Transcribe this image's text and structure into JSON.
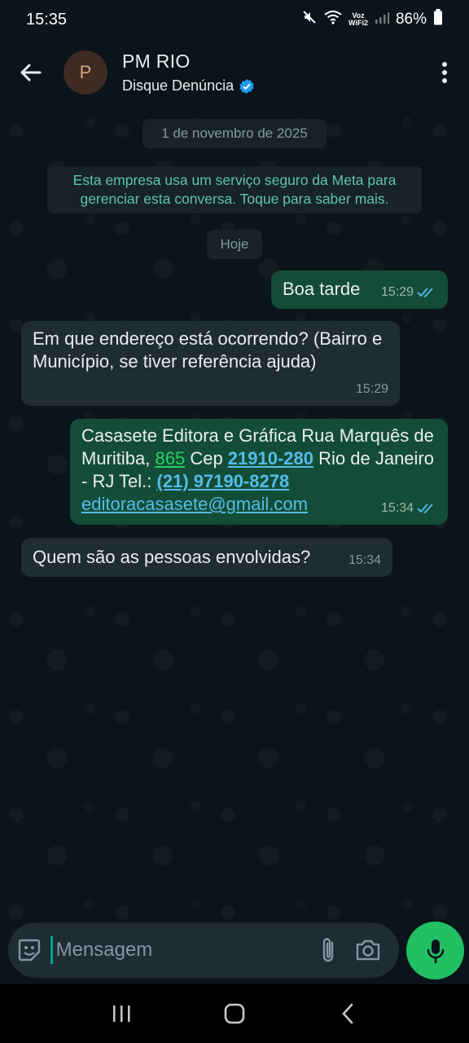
{
  "status_bar": {
    "time": "15:35",
    "voz_line1": "Voz",
    "voz_line2": "WiFi2",
    "battery": "86%"
  },
  "header": {
    "avatar_letter": "P",
    "name": "PM RIO",
    "subtitle": "Disque Denúncia",
    "verified_icon": "verified-badge-icon"
  },
  "chat": {
    "date_pill": "1 de novembro de 2025",
    "info_notice": "Esta empresa usa um serviço seguro da Meta para gerenciar esta conversa. Toque para saber mais.",
    "today_pill": "Hoje",
    "messages": [
      {
        "direction": "out",
        "text": "Boa tarde",
        "time": "15:29",
        "status": "read"
      },
      {
        "direction": "in",
        "text": "Em que endereço está ocorrendo? (Bairro e Município, se tiver referência ajuda)",
        "time": "15:29"
      },
      {
        "direction": "out",
        "text_part1": "Casasete Editora e Gráfica Rua Marquês de Muritiba, ",
        "number": "865",
        "text_part2": " Cep ",
        "cep": "21910-280",
        "text_part3": " Rio de Janeiro - RJ Tel.: ",
        "phone": "(21) 97190-8278",
        "email": "editoracasasete@gmail.com",
        "time": "15:34",
        "status": "read"
      },
      {
        "direction": "in",
        "text": "Quem são as pessoas envolvidas?",
        "time": "15:34"
      }
    ]
  },
  "input": {
    "placeholder": "Mensagem"
  },
  "colors": {
    "background": "#0b141a",
    "outgoing_bubble": "#144d37",
    "incoming_bubble": "#202c33",
    "accent_green": "#21c063",
    "read_ticks": "#53bdeb",
    "link_blue": "#53bdeb"
  }
}
